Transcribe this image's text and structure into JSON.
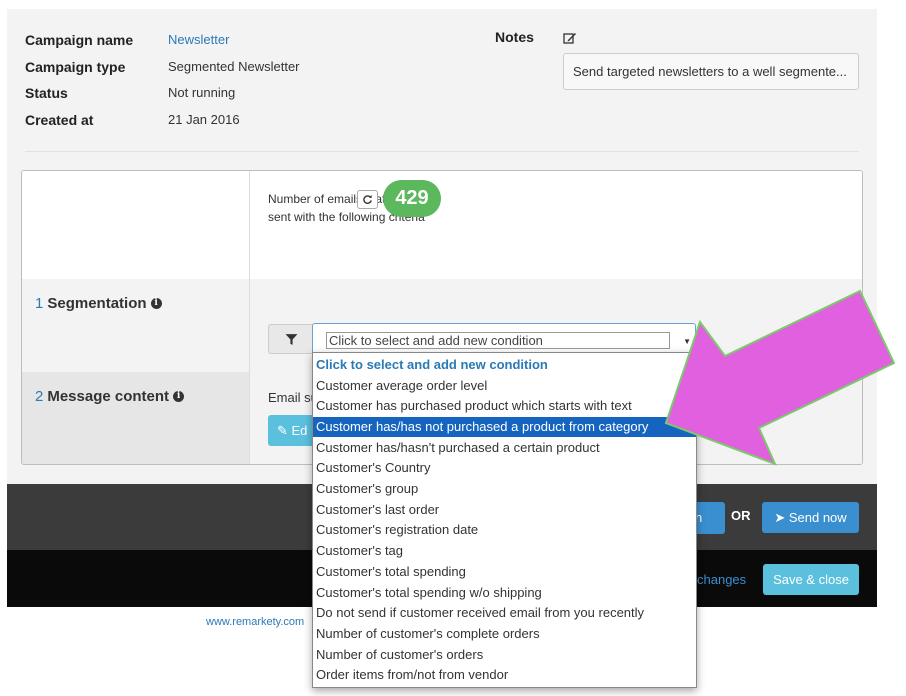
{
  "campaign": {
    "fields": [
      {
        "label": "Campaign name",
        "value": "Newsletter"
      },
      {
        "label": "Campaign type",
        "value": "Segmented Newsletter"
      },
      {
        "label": "Status",
        "value": "Not running"
      },
      {
        "label": "Created at",
        "value": "21 Jan 2016"
      }
    ],
    "notes_label": "Notes",
    "notes_value": "Send targeted newsletters to a well segmente..."
  },
  "panel": {
    "count_text": "Number of emails that will be sent with the following criteria",
    "count": "429",
    "segmentation": {
      "num": "1",
      "title": "Segmentation"
    },
    "message": {
      "num": "2",
      "title": "Message content"
    },
    "email_subject_partial": "Email su",
    "edit_partial": "Ed",
    "select_placeholder": "Click to select and add new condition"
  },
  "dropdown": {
    "items": [
      "Click to select and add new condition",
      "Customer average order level",
      "Customer has purchased product which starts with text",
      "Customer has/has not purchased a product from category",
      "Customer has/hasn't purchased a certain product",
      "Customer's Country",
      "Customer's group",
      "Customer's last order",
      "Customer's registration date",
      "Customer's tag",
      "Customer's total spending",
      "Customer's total spending w/o shipping",
      "Do not send if customer received email from you recently",
      "Number of customer's complete orders",
      "Number of customer's orders",
      "Order items from/not from vendor"
    ],
    "selected_index": 3
  },
  "actions": {
    "partial_button": "n",
    "or_text": "OR",
    "send_now": "Send now",
    "changes_partial": "changes",
    "save_close": "Save & close"
  },
  "footer": {
    "link_partial": "www.remarkety.com"
  },
  "colors": {
    "accent": "#2a7ab6",
    "count_badge": "#5cb85c",
    "selected_item": "#1565c0",
    "arrow": "#e060e0"
  }
}
